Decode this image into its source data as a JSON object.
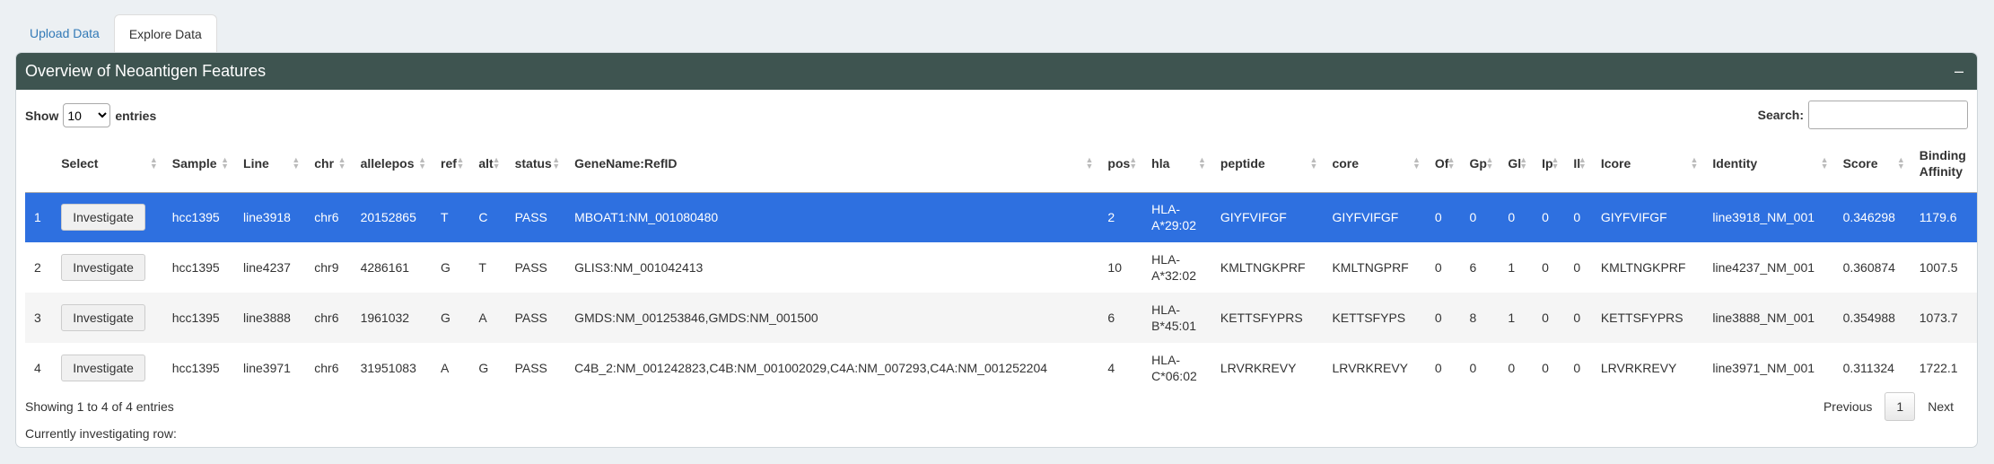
{
  "tabs": [
    {
      "label": "Upload Data",
      "active": false
    },
    {
      "label": "Explore Data",
      "active": true
    }
  ],
  "panel": {
    "title": "Overview of Neoantigen Features",
    "collapse_label": "–"
  },
  "length": {
    "show_label": "Show",
    "selected": "10",
    "entries_label": "entries"
  },
  "search": {
    "label": "Search:",
    "value": "",
    "placeholder": ""
  },
  "columns": [
    "",
    "Select",
    "Sample",
    "Line",
    "chr",
    "allelepos",
    "ref",
    "alt",
    "status",
    "GeneName:RefID",
    "pos",
    "hla",
    "peptide",
    "core",
    "Of",
    "Gp",
    "Gl",
    "Ip",
    "Il",
    "Icore",
    "Identity",
    "Score",
    "Binding Affinity"
  ],
  "button_label": "Investigate",
  "rows": [
    {
      "n": "1",
      "sample": "hcc1395",
      "line": "line3918",
      "chr": "chr6",
      "allelepos": "20152865",
      "ref": "T",
      "alt": "C",
      "status": "PASS",
      "gene": "MBOAT1:NM_001080480",
      "pos": "2",
      "hla": "HLA-A*29:02",
      "peptide": "GIYFVIFGF",
      "core": "GIYFVIFGF",
      "of": "0",
      "gp": "0",
      "gl": "0",
      "ip": "0",
      "il": "0",
      "icore": "GIYFVIFGF",
      "identity": "line3918_NM_001",
      "score": "0.346298",
      "ba": "1179.6"
    },
    {
      "n": "2",
      "sample": "hcc1395",
      "line": "line4237",
      "chr": "chr9",
      "allelepos": "4286161",
      "ref": "G",
      "alt": "T",
      "status": "PASS",
      "gene": "GLIS3:NM_001042413",
      "pos": "10",
      "hla": "HLA-A*32:02",
      "peptide": "KMLTNGKPRF",
      "core": "KMLTNGPRF",
      "of": "0",
      "gp": "6",
      "gl": "1",
      "ip": "0",
      "il": "0",
      "icore": "KMLTNGKPRF",
      "identity": "line4237_NM_001",
      "score": "0.360874",
      "ba": "1007.5"
    },
    {
      "n": "3",
      "sample": "hcc1395",
      "line": "line3888",
      "chr": "chr6",
      "allelepos": "1961032",
      "ref": "G",
      "alt": "A",
      "status": "PASS",
      "gene": "GMDS:NM_001253846,GMDS:NM_001500",
      "pos": "6",
      "hla": "HLA-B*45:01",
      "peptide": "KETTSFYPRS",
      "core": "KETTSFYPS",
      "of": "0",
      "gp": "8",
      "gl": "1",
      "ip": "0",
      "il": "0",
      "icore": "KETTSFYPRS",
      "identity": "line3888_NM_001",
      "score": "0.354988",
      "ba": "1073.7"
    },
    {
      "n": "4",
      "sample": "hcc1395",
      "line": "line3971",
      "chr": "chr6",
      "allelepos": "31951083",
      "ref": "A",
      "alt": "G",
      "status": "PASS",
      "gene": "C4B_2:NM_001242823,C4B:NM_001002029,C4A:NM_007293,C4A:NM_001252204",
      "pos": "4",
      "hla": "HLA-C*06:02",
      "peptide": "LRVRKREVY",
      "core": "LRVRKREVY",
      "of": "0",
      "gp": "0",
      "gl": "0",
      "ip": "0",
      "il": "0",
      "icore": "LRVRKREVY",
      "identity": "line3971_NM_001",
      "score": "0.311324",
      "ba": "1722.1"
    }
  ],
  "selected_row": 0,
  "info": "Showing 1 to 4 of 4 entries",
  "investigating": "Currently investigating row:",
  "pager": {
    "previous": "Previous",
    "current": "1",
    "next": "Next"
  },
  "colors": {
    "header_bg": "#3e5450",
    "selected_bg": "#2e70e0",
    "link": "#337ab7"
  }
}
